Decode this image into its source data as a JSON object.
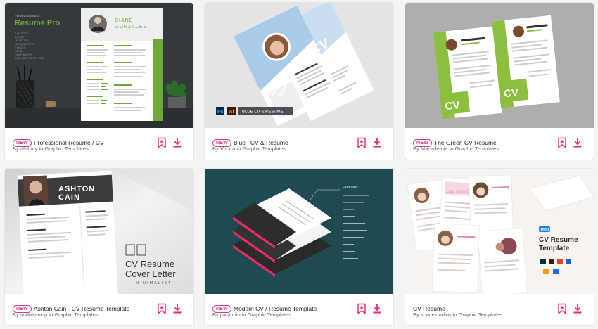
{
  "colors": {
    "accent": "#e82a66",
    "badge": "#d23c8f"
  },
  "cards": [
    {
      "badge": "NEW",
      "title": "Professional Resume / CV",
      "byline": "By afahmy in Graphic Templates",
      "thumb": {
        "label1": "PROFESSIONAL",
        "label2": "Resume Pro",
        "features": [
          "A4 LETTER",
          "A4 SIZE",
          "US LETTER",
          "EDITABLE TEXT",
          "2 PAGES",
          "NOTES",
          "CMYK 300 DPI",
          "SCALABLE TO ANY SIZE"
        ],
        "name1": "DIANE",
        "name2": "GONZALES"
      }
    },
    {
      "badge": "NEW",
      "title": "Blue | CV & Resume",
      "byline": "By Vunira in Graphic Templates",
      "thumb": {
        "cv": "CV",
        "name1": "ADELIA",
        "name2": "SUAREX",
        "ps": "Ps",
        "ai": "Ai",
        "caption": "BLUE CV & RESUME"
      }
    },
    {
      "badge": "NEW",
      "title": "The Green CV Resume",
      "byline": "By Macademia in Graphic Templates",
      "thumb": {
        "cv": "CV"
      }
    },
    {
      "badge": "NEW",
      "title": "Ashton Cain - CV Resume Template",
      "byline": "By suduttancip in Graphic Templates",
      "thumb": {
        "name1": "ASHTON",
        "name2": "CAIN",
        "line1": "CV Resume",
        "line2": "Cover Letter",
        "line3": "MINIMALIST"
      }
    },
    {
      "badge": "NEW",
      "title": "Modern CV / Resume Template",
      "byline": "By jiwstudio in Graphic Templates",
      "thumb": {
        "features_title": "Features :"
      }
    },
    {
      "badge": "",
      "title": "CV Resume",
      "byline": "By spacestudios in Graphic Templates",
      "thumb": {
        "pro": "PRO",
        "line1": "CV Resume",
        "line2": "Template",
        "script": "Lisa Crawly"
      }
    }
  ]
}
